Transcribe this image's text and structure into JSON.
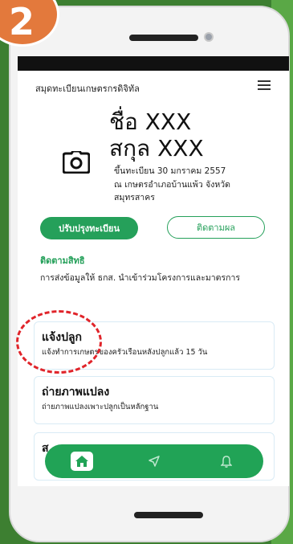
{
  "step": {
    "number": "2"
  },
  "app": {
    "title": "สมุดทะเบียนเกษตรกรดิจิทัล"
  },
  "profile": {
    "name_line": "ชื่อ XXX",
    "surname_line": "สกุล XXX",
    "registered_line": "ขึ้นทะเบียน 30 มกราคม 2557",
    "location_line1": "ณ เกษตรอำเภอบ้านแพ้ว จังหวัด",
    "location_line2": "สมุทรสาคร"
  },
  "actions": {
    "update_label": "ปรับปรุงทะเบียน",
    "track_label": "ติดตามผล"
  },
  "rights": {
    "title": "ติดตามสิทธิ",
    "description": "การส่งข้อมูลให้ ธกส. นำเข้าร่วมโครงการและมาตรการ"
  },
  "cards": [
    {
      "title": "แจ้งปลูก",
      "subtitle": "แจ้งทำการเกษตรของครัวเรือนหลังปลูกแล้ว 15 วัน"
    },
    {
      "title": "ถ่ายภาพแปลง",
      "subtitle": "ถ่ายภาพแปลงเพาะปลูกเป็นหลักฐาน"
    },
    {
      "title": "ส",
      "subtitle": ""
    }
  ],
  "icons": {
    "menu": "hamburger-icon",
    "camera": "camera-icon",
    "home": "home-icon",
    "send": "send-icon",
    "bell": "bell-icon"
  },
  "colors": {
    "primary_green": "#25a05a",
    "nav_green": "#21a356",
    "highlight_red": "#e0242a",
    "badge_orange": "#e3793c",
    "background_green": "#4e9a3e"
  }
}
